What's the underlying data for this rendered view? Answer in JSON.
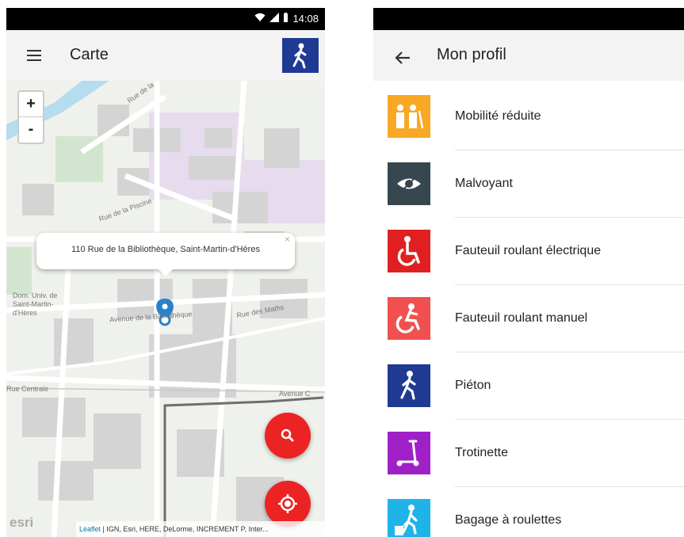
{
  "left_screen": {
    "status_time": "14:08",
    "title": "Carte",
    "profile_icon": "pedestrian-icon",
    "zoom_in": "+",
    "zoom_out": "-",
    "popup_address": "110 Rue de la Bibliothèque, Saint-Martin-d'Hères",
    "popup_close": "×",
    "map_labels": {
      "rue_de_la": "Rue de la",
      "rue_piscine": "Rue de la Piscine",
      "dom_univ": "Dom. Univ. de Saint-Martin-d'Hères",
      "avenue_bibliotheque": "Avenue de la Bibliothèque",
      "rue_des_maths": "Rue des Maths",
      "rue_centrale": "Rue Centrale",
      "avenue_c": "Avenue C"
    },
    "esri_logo": "esri",
    "attribution_leaflet": "Leaflet",
    "attribution_rest": " | IGN, Esri, HERE, DeLorme, INCREMENT P, Inter...",
    "fab_search_icon": "search-icon",
    "fab_locate_icon": "locate-icon"
  },
  "right_screen": {
    "title": "Mon profil",
    "back_icon": "arrow-back-icon",
    "items": [
      {
        "label": "Mobilité réduite",
        "color": "#f9a825",
        "icon": "elderly-icon"
      },
      {
        "label": "Malvoyant",
        "color": "#37474f",
        "icon": "eye-icon"
      },
      {
        "label": "Fauteuil roulant électrique",
        "color": "#e02020",
        "icon": "wheelchair-icon"
      },
      {
        "label": "Fauteuil roulant manuel",
        "color": "#f05050",
        "icon": "manual-wheelchair-icon"
      },
      {
        "label": "Piéton",
        "color": "#1f3a93",
        "icon": "pedestrian-icon"
      },
      {
        "label": "Trotinette",
        "color": "#a020c8",
        "icon": "scooter-icon"
      },
      {
        "label": "Bagage à roulettes",
        "color": "#1fb4e8",
        "icon": "luggage-icon"
      }
    ]
  },
  "colors": {
    "accent_red": "#ec2323",
    "pedestrian_blue": "#1f3a93",
    "map_bg": "#eff1ec"
  }
}
